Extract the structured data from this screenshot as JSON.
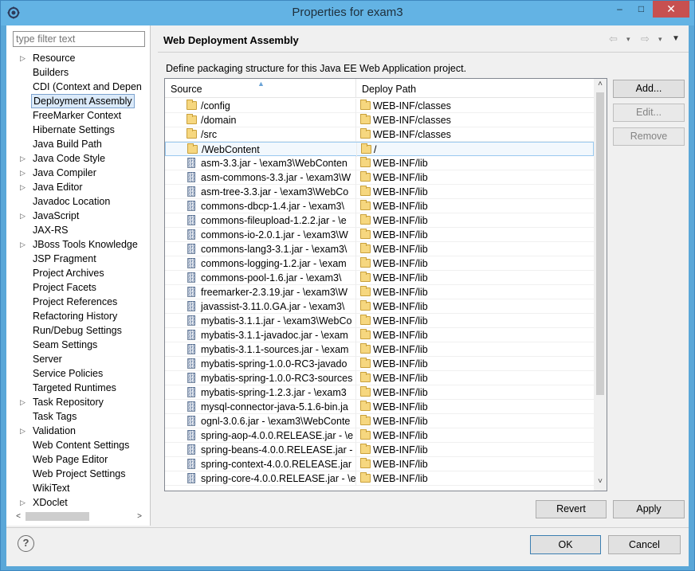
{
  "window": {
    "title": "Properties for exam3",
    "minimize_glyph": "–",
    "maximize_glyph": "□",
    "close_glyph": "✕"
  },
  "filter": {
    "placeholder": "type filter text",
    "value": ""
  },
  "tree": [
    {
      "label": "Resource",
      "expandable": true
    },
    {
      "label": "Builders",
      "expandable": false
    },
    {
      "label": "CDI (Context and Depen",
      "expandable": false
    },
    {
      "label": "Deployment Assembly",
      "expandable": false,
      "selected": true
    },
    {
      "label": "FreeMarker Context",
      "expandable": false
    },
    {
      "label": "Hibernate Settings",
      "expandable": false
    },
    {
      "label": "Java Build Path",
      "expandable": false
    },
    {
      "label": "Java Code Style",
      "expandable": true
    },
    {
      "label": "Java Compiler",
      "expandable": true
    },
    {
      "label": "Java Editor",
      "expandable": true
    },
    {
      "label": "Javadoc Location",
      "expandable": false
    },
    {
      "label": "JavaScript",
      "expandable": true
    },
    {
      "label": "JAX-RS",
      "expandable": false
    },
    {
      "label": "JBoss Tools Knowledge",
      "expandable": true
    },
    {
      "label": "JSP Fragment",
      "expandable": false
    },
    {
      "label": "Project Archives",
      "expandable": false
    },
    {
      "label": "Project Facets",
      "expandable": false
    },
    {
      "label": "Project References",
      "expandable": false
    },
    {
      "label": "Refactoring History",
      "expandable": false
    },
    {
      "label": "Run/Debug Settings",
      "expandable": false
    },
    {
      "label": "Seam Settings",
      "expandable": false
    },
    {
      "label": "Server",
      "expandable": false
    },
    {
      "label": "Service Policies",
      "expandable": false
    },
    {
      "label": "Targeted Runtimes",
      "expandable": false
    },
    {
      "label": "Task Repository",
      "expandable": true
    },
    {
      "label": "Task Tags",
      "expandable": false
    },
    {
      "label": "Validation",
      "expandable": true
    },
    {
      "label": "Web Content Settings",
      "expandable": false
    },
    {
      "label": "Web Page Editor",
      "expandable": false
    },
    {
      "label": "Web Project Settings",
      "expandable": false
    },
    {
      "label": "WikiText",
      "expandable": false
    },
    {
      "label": "XDoclet",
      "expandable": true
    }
  ],
  "page": {
    "title": "Web Deployment Assembly",
    "description": "Define packaging structure for this Java EE Web Application project.",
    "nav": {
      "back": "⇦",
      "back_menu": "▾",
      "forward": "⇨",
      "forward_menu": "▾",
      "menu": "▼"
    }
  },
  "table": {
    "columns": {
      "source": "Source",
      "deploy": "Deploy Path"
    },
    "rows": [
      {
        "source": "/config",
        "source_icon": "folder-icon",
        "deploy": "WEB-INF/classes"
      },
      {
        "source": "/domain",
        "source_icon": "folder-icon",
        "deploy": "WEB-INF/classes"
      },
      {
        "source": "/src",
        "source_icon": "folder-icon",
        "deploy": "WEB-INF/classes"
      },
      {
        "source": "/WebContent",
        "source_icon": "folder-icon",
        "deploy": "/",
        "selected": true
      },
      {
        "source": "asm-3.3.jar - \\exam3\\WebConten",
        "source_icon": "jar-icon",
        "deploy": "WEB-INF/lib"
      },
      {
        "source": "asm-commons-3.3.jar - \\exam3\\W",
        "source_icon": "jar-icon",
        "deploy": "WEB-INF/lib"
      },
      {
        "source": "asm-tree-3.3.jar - \\exam3\\WebCo",
        "source_icon": "jar-icon",
        "deploy": "WEB-INF/lib"
      },
      {
        "source": "commons-dbcp-1.4.jar - \\exam3\\",
        "source_icon": "jar-icon",
        "deploy": "WEB-INF/lib"
      },
      {
        "source": "commons-fileupload-1.2.2.jar - \\e",
        "source_icon": "jar-icon",
        "deploy": "WEB-INF/lib"
      },
      {
        "source": "commons-io-2.0.1.jar - \\exam3\\W",
        "source_icon": "jar-icon",
        "deploy": "WEB-INF/lib"
      },
      {
        "source": "commons-lang3-3.1.jar - \\exam3\\",
        "source_icon": "jar-icon",
        "deploy": "WEB-INF/lib"
      },
      {
        "source": "commons-logging-1.2.jar - \\exam",
        "source_icon": "jar-icon",
        "deploy": "WEB-INF/lib"
      },
      {
        "source": "commons-pool-1.6.jar - \\exam3\\",
        "source_icon": "jar-icon",
        "deploy": "WEB-INF/lib"
      },
      {
        "source": "freemarker-2.3.19.jar - \\exam3\\W",
        "source_icon": "jar-icon",
        "deploy": "WEB-INF/lib"
      },
      {
        "source": "javassist-3.11.0.GA.jar - \\exam3\\",
        "source_icon": "jar-icon",
        "deploy": "WEB-INF/lib"
      },
      {
        "source": "mybatis-3.1.1.jar - \\exam3\\WebCo",
        "source_icon": "jar-icon",
        "deploy": "WEB-INF/lib"
      },
      {
        "source": "mybatis-3.1.1-javadoc.jar - \\exam",
        "source_icon": "jar-icon",
        "deploy": "WEB-INF/lib"
      },
      {
        "source": "mybatis-3.1.1-sources.jar - \\exam",
        "source_icon": "jar-icon",
        "deploy": "WEB-INF/lib"
      },
      {
        "source": "mybatis-spring-1.0.0-RC3-javado",
        "source_icon": "jar-icon",
        "deploy": "WEB-INF/lib"
      },
      {
        "source": "mybatis-spring-1.0.0-RC3-sources",
        "source_icon": "jar-icon",
        "deploy": "WEB-INF/lib"
      },
      {
        "source": "mybatis-spring-1.2.3.jar - \\exam3",
        "source_icon": "jar-icon",
        "deploy": "WEB-INF/lib"
      },
      {
        "source": "mysql-connector-java-5.1.6-bin.ja",
        "source_icon": "jar-icon",
        "deploy": "WEB-INF/lib"
      },
      {
        "source": "ognl-3.0.6.jar - \\exam3\\WebConte",
        "source_icon": "jar-icon",
        "deploy": "WEB-INF/lib"
      },
      {
        "source": "spring-aop-4.0.0.RELEASE.jar - \\e",
        "source_icon": "jar-icon",
        "deploy": "WEB-INF/lib"
      },
      {
        "source": "spring-beans-4.0.0.RELEASE.jar -",
        "source_icon": "jar-icon",
        "deploy": "WEB-INF/lib"
      },
      {
        "source": "spring-context-4.0.0.RELEASE.jar",
        "source_icon": "jar-icon",
        "deploy": "WEB-INF/lib"
      },
      {
        "source": "spring-core-4.0.0.RELEASE.jar - \\e",
        "source_icon": "jar-icon",
        "deploy": "WEB-INF/lib"
      }
    ]
  },
  "buttons": {
    "add": "Add...",
    "edit": "Edit...",
    "remove": "Remove",
    "revert": "Revert",
    "apply": "Apply",
    "ok": "OK",
    "cancel": "Cancel",
    "help": "?"
  },
  "colors": {
    "titlebar": "#63b3e4",
    "close_button": "#c75050",
    "selection": "#dbeaf9"
  }
}
